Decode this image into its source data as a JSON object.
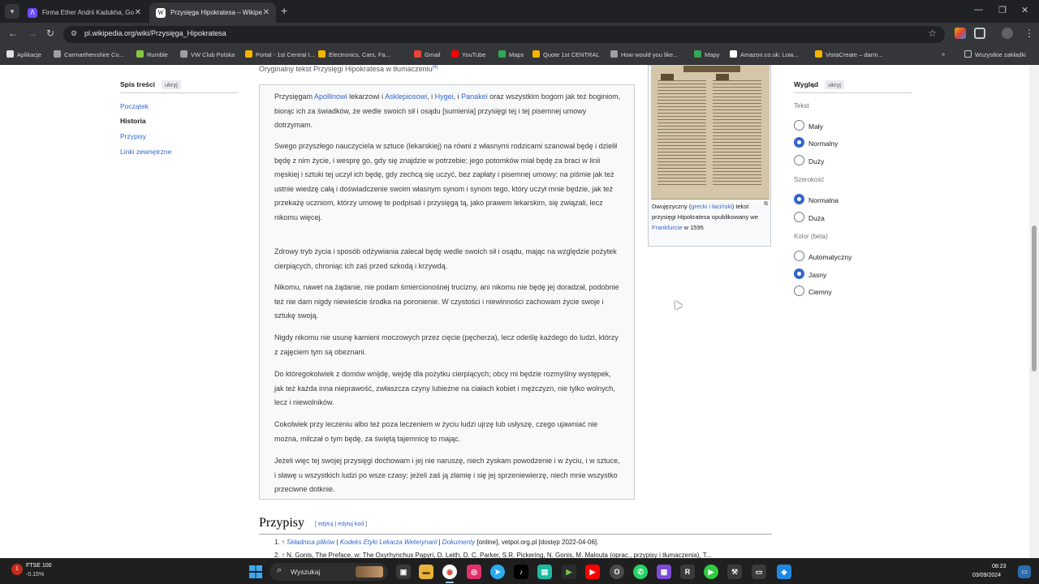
{
  "browser": {
    "tabs": [
      {
        "title": "Firma Ether Andrii Kadukha, Go",
        "icon": "proton-icon",
        "active": false
      },
      {
        "title": "Przysięga Hipokratesa – Wikipe",
        "icon": "wikipedia-icon",
        "active": true
      }
    ],
    "url": "pl.wikipedia.org/wiki/Przysięga_Hipokratesa",
    "bookmarks": [
      {
        "label": "Aplikacje",
        "color": "#e0e0e0"
      },
      {
        "label": "Carmarthenshire Co...",
        "color": "#9aa0a6"
      },
      {
        "label": "Rumble",
        "color": "#85c742"
      },
      {
        "label": "VW Club Polska",
        "color": "#9aa0a6"
      },
      {
        "label": "Portal - 1st Central I...",
        "color": "#f4b400"
      },
      {
        "label": "Electronics, Cars, Fa...",
        "color": "#f4b400"
      },
      {
        "label": "Gmail",
        "color": "#ea4335"
      },
      {
        "label": "YouTube",
        "color": "#ff0000"
      },
      {
        "label": "Maps",
        "color": "#34a853"
      },
      {
        "label": "Quote 1st CENTRAL",
        "color": "#f4b400"
      },
      {
        "label": "How would you like...",
        "color": "#9aa0a6"
      },
      {
        "label": "Mapy",
        "color": "#34a853"
      },
      {
        "label": "Amazon.co.uk: Low...",
        "color": "#ffffff"
      },
      {
        "label": "VistaCreate – darm...",
        "color": "#f4b400"
      }
    ],
    "bookmarks_all": "Wszystkie zakładki"
  },
  "toc": {
    "title": "Spis treści",
    "hide_label": "ukryj",
    "items": [
      {
        "label": "Początek",
        "current": false
      },
      {
        "label": "Historia",
        "current": true
      },
      {
        "label": "Przypisy",
        "current": false
      },
      {
        "label": "Linki zewnętrzne",
        "current": false
      }
    ]
  },
  "article": {
    "caption_top": "Oryginalny tekst Przysięgi Hipokratesa w tłumaczeniu",
    "caption_ref": "[4]",
    "p1": {
      "pre": "Przysięgam ",
      "l1": "Apollinowi",
      "m1": " lekarzowi i ",
      "l2": "Asklepiosowi",
      "m2": ", i ",
      "l3": "Hygei",
      "m3": ", i ",
      "l4": "Panakei",
      "post": " oraz wszystkim bogom jak też boginiom, biorąc ich za świadków, że wedle swoich sił i osądu [sumienia] przysięgi tej i tej pisemnej umowy dotrzymam."
    },
    "paragraphs": [
      "Swego przyszłego nauczyciela w sztuce (lekarskiej) na równi z własnymi rodzicami szanował będę i dzielił będę z nim życie, i wesprę go, gdy się znajdzie w potrzebie; jego potomków miał będę za braci w linii męskiej i sztuki tej uczył ich będę, gdy zechcą się uczyć, bez zapłaty i pisemnej umowy; na piśmie jak też ustnie wiedzę całą i doświadczenie swoim własnym synom i synom tego, który uczył mnie będzie, jak też przekażę uczniom, którzy umowę te podpisali i przysięgą tą, jako prawem lekarskim, się związali, lecz nikomu więcej.",
      "Zdrowy tryb życia i sposób odżywiania zalecał będę wedle swoich sił i osądu, mając na względzie pożytek cierpiących, chroniąc ich zaś przed szkodą i krzywdą.",
      "Nikomu, nawet na żądanie, nie podam śmiercionośnej trucizny, ani nikomu nie będę jej doradzał, podobnie też nie dam nigdy niewieście środka na poronienie. W czystości i niewinności zachowam życie swoje i sztukę swoją.",
      "Nigdy nikomu nie usunę kamieni moczowych przez cięcie (pęcherza), lecz odeślę każdego do ludzi, którzy z zajęciem tym są obeznani.",
      "Do któregokolwiek z domów wnijdę, wejdę dla pożytku cierpiących; obcy mi będzie rozmyślny występek, jak też każda inna nieprawość, zwłaszcza czyny lubieżne na ciałach kobiet i mężczyzn, nie tylko wolnych, lecz i niewolników.",
      "Cokolwiek przy leczeniu albo też poza leczeniem w życiu ludzi ujrzę lub usłyszę, czego ujawniać nie można, milczał o tym będę, za świętą tajemnicę to mając.",
      "Jeżeli więc tej swojej przysięgi dochowam i jej nie naruszę, niech zyskam powodzenie i w życiu, i w sztuce, i sławę u wszystkich ludzi po wsze czasy; jeżeli zaś ją złamię i się jej sprzeniewierzę, niech mnie wszystko przeciwne dotknie."
    ]
  },
  "figure": {
    "caption_pre": "Dwujęzyczny (",
    "link_greek": "grecki i łaciński",
    "caption_mid": ") tekst przysięgi Hipokratesa opublikowany we ",
    "link_city": "Frankfurcie",
    "caption_post": " w 1595",
    "image_title_text": "IVSIVRANDVM."
  },
  "appearance": {
    "title": "Wygląd",
    "hide_label": "ukryj",
    "text_label": "Tekst",
    "text_options": [
      {
        "label": "Mały",
        "selected": false
      },
      {
        "label": "Normalny",
        "selected": true
      },
      {
        "label": "Duży",
        "selected": false
      }
    ],
    "width_label": "Szerokość",
    "width_options": [
      {
        "label": "Normalna",
        "selected": true
      },
      {
        "label": "Duża",
        "selected": false
      }
    ],
    "color_label": "Kolor (beta)",
    "color_options": [
      {
        "label": "Automatyczny",
        "selected": false
      },
      {
        "label": "Jasny",
        "selected": true
      },
      {
        "label": "Ciemny",
        "selected": false
      }
    ]
  },
  "references": {
    "title": "Przypisy",
    "edit_open": "[ ",
    "edit": "edytuj",
    "edit_sep": " | ",
    "edit_code": "edytuj kod",
    "edit_close": " ]",
    "ref1": {
      "num": "1. ↑ ",
      "l1": "Składnica plików",
      "s1": " | ",
      "l2": "Kodeks Etyki Lekarza Weterynarii",
      "s2": " | ",
      "l3": "Dokumenty",
      "post": " [online], vetpol.org.pl [dostęp 2022-04-06]."
    },
    "ref2": "2. ↑ N. Gonis, The Preface, w: The Oxyrhynchus Papyri, D. Leith, D. C. Parker, S.R. Pickering, N. Gonis, M. Malouta (oprac., przypisy i tłumaczenia), T..."
  },
  "taskbar": {
    "stock_name": "FTSE 100",
    "stock_change": "-0.15%",
    "search_placeholder": "Wyszukaj",
    "time": "08:23",
    "date": "03/09/2024"
  }
}
